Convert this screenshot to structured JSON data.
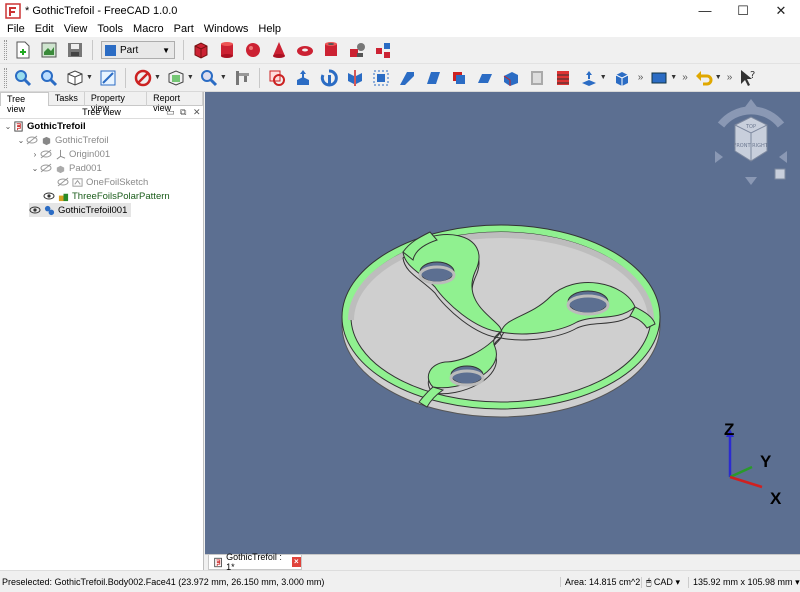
{
  "window": {
    "title": "* GothicTrefoil - FreeCAD 1.0.0",
    "minimize": "—",
    "maximize": "☐",
    "close": "✕"
  },
  "menu": [
    "File",
    "Edit",
    "View",
    "Tools",
    "Macro",
    "Part",
    "Windows",
    "Help"
  ],
  "workbench": {
    "label": "Part"
  },
  "panel": {
    "tabs": [
      "Tree view",
      "Tasks",
      "Property view",
      "Report view"
    ],
    "header": "Tree view",
    "tree": [
      {
        "label": "GothicTrefoil",
        "style": "bold"
      },
      {
        "label": "GothicTrefoil",
        "style": "gray"
      },
      {
        "label": "Origin001",
        "style": "gray"
      },
      {
        "label": "Pad001",
        "style": "gray"
      },
      {
        "label": "OneFoilSketch",
        "style": "gray"
      },
      {
        "label": "ThreeFoilsPolarPattern",
        "style": "green"
      },
      {
        "label": "GothicTrefoil001",
        "style": "normal"
      }
    ]
  },
  "navcube": {
    "top": "TOP",
    "front": "FRONT",
    "right": "RIGHT"
  },
  "axes": {
    "z": "Z",
    "y": "Y",
    "x": "X"
  },
  "doc_tab": {
    "label": "GothicTrefoil : 1*",
    "close": "×"
  },
  "status": {
    "message": "Preselected: GothicTrefoil.Body002.Face41 (23.972 mm, 26.150 mm, 3.000 mm)",
    "area": "Area: 14.815 cm^2",
    "nav_style": "CAD",
    "dimensions": "135.92 mm x 105.98 mm"
  },
  "colors": {
    "viewport_bg": "#5c6f91",
    "face": "#90f190",
    "side": "#cfcfcf"
  },
  "icons": {
    "toolbar1": [
      "new-icon",
      "open-icon",
      "save-icon",
      "box-icon",
      "cylinder-icon",
      "sphere-icon",
      "cone-icon",
      "torus-icon",
      "tube-icon",
      "primitives-icon",
      "shape-builder-icon"
    ],
    "toolbar2": [
      "fit-all-icon",
      "fit-selection-icon",
      "std-views-icon",
      "measure-icon",
      "draw-style-icon",
      "bounding-box-icon",
      "zoom-icon",
      "caliper-icon",
      "boolean-icon",
      "extrude-icon",
      "revolve-icon",
      "mirror-icon",
      "fillet-icon",
      "chamfer-icon",
      "make-face-icon",
      "ruled-surface-icon",
      "loft-icon",
      "sweep-icon",
      "section-icon",
      "cross-sections-icon",
      "offset-icon",
      "thickness-icon",
      "view-box-icon",
      "undo-icon",
      "whats-this-icon"
    ]
  }
}
